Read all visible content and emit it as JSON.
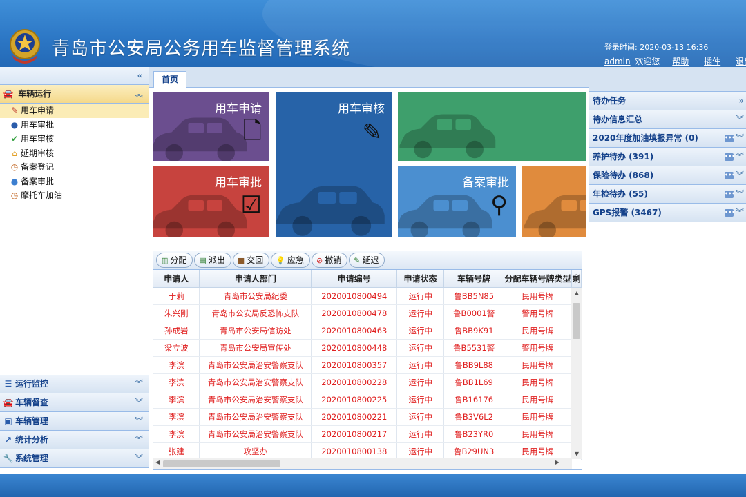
{
  "header": {
    "title": "青岛市公安局公务用车监督管理系统",
    "login_time_label": "登录时间:",
    "login_time": "2020-03-13 16:36",
    "user": "admin",
    "welcome": "欢迎您",
    "help": "帮助",
    "plugin": "插件",
    "logout": "退出"
  },
  "sidebar": {
    "collapse_icon": "«",
    "active_section": {
      "label": "车辆运行",
      "icon": "car-icon",
      "chevron": "︽",
      "items": [
        {
          "label": "用车申请",
          "icon": "edit-icon",
          "glyph": "✎",
          "color": "#c0392b",
          "selected": true
        },
        {
          "label": "用车审批",
          "icon": "approve-icon",
          "glyph": "●",
          "color": "#2a5caa"
        },
        {
          "label": "用车审核",
          "icon": "check-icon",
          "glyph": "✔",
          "color": "#2e9e3a"
        },
        {
          "label": "延期审核",
          "icon": "home-icon",
          "glyph": "⌂",
          "color": "#e2a12a"
        },
        {
          "label": "备案登记",
          "icon": "clock-icon",
          "glyph": "◷",
          "color": "#c0601a"
        },
        {
          "label": "备案审批",
          "icon": "globe-icon",
          "glyph": "●",
          "color": "#3c7fd0"
        },
        {
          "label": "摩托车加油",
          "icon": "clock-icon",
          "glyph": "◷",
          "color": "#c0601a"
        }
      ]
    },
    "sections": [
      {
        "label": "运行监控",
        "icon": "list-icon",
        "glyph": "☰",
        "chevron": "︾"
      },
      {
        "label": "车辆督查",
        "icon": "car-icon",
        "glyph": "🚘",
        "chevron": "︾"
      },
      {
        "label": "车辆管理",
        "icon": "folder-icon",
        "glyph": "▣",
        "chevron": "︾"
      },
      {
        "label": "统计分析",
        "icon": "chart-icon",
        "glyph": "↗",
        "chevron": "︾"
      },
      {
        "label": "系统管理",
        "icon": "wrench-icon",
        "glyph": "🔧",
        "chevron": "︾"
      }
    ]
  },
  "tabs": {
    "home": "首页"
  },
  "tiles": {
    "apply": {
      "label": "用车申请",
      "color": "#6b4e8f"
    },
    "review": {
      "label": "用车审核",
      "color": "#2763a8"
    },
    "approve": {
      "label": "用车审批",
      "color": "#c7433e"
    },
    "filing": {
      "label": "备案审批",
      "color": "#4b8fd0"
    },
    "green_color": "#3e9f6c",
    "orange_color": "#e08b3d"
  },
  "toolbar": [
    {
      "label": "分配",
      "icon": "assign-icon",
      "glyph": "▥",
      "color": "#2e7d32"
    },
    {
      "label": "派出",
      "icon": "dispatch-icon",
      "glyph": "▤",
      "color": "#2e7d32"
    },
    {
      "label": "交回",
      "icon": "return-icon",
      "glyph": "■",
      "color": "#8b5a2b"
    },
    {
      "label": "应急",
      "icon": "bulb-icon",
      "glyph": "💡",
      "color": "#e0a020"
    },
    {
      "label": "撤销",
      "icon": "cancel-icon",
      "glyph": "⊘",
      "color": "#d32f2f"
    },
    {
      "label": "延迟",
      "icon": "pencil-icon",
      "glyph": "✎",
      "color": "#2e7d32"
    }
  ],
  "table": {
    "columns": [
      "申请人",
      "申请人部门",
      "申请编号",
      "申请状态",
      "车辆号牌",
      "分配车辆号牌类型",
      "剩"
    ],
    "rows": [
      [
        "于莉",
        "青岛市公安局纪委",
        "2020010800494",
        "运行中",
        "鲁BB5N85",
        "民用号牌",
        ""
      ],
      [
        "朱兴刚",
        "青岛市公安局反恐怖支队",
        "2020010800478",
        "运行中",
        "鲁B0001警",
        "警用号牌",
        ""
      ],
      [
        "孙成岩",
        "青岛市公安局信访处",
        "2020010800463",
        "运行中",
        "鲁BB9K91",
        "民用号牌",
        ""
      ],
      [
        "梁立波",
        "青岛市公安局宣传处",
        "2020010800448",
        "运行中",
        "鲁B5531警",
        "警用号牌",
        ""
      ],
      [
        "李滨",
        "青岛市公安局治安警察支队",
        "2020010800357",
        "运行中",
        "鲁BB9L88",
        "民用号牌",
        ""
      ],
      [
        "李滨",
        "青岛市公安局治安警察支队",
        "2020010800228",
        "运行中",
        "鲁BB1L69",
        "民用号牌",
        ""
      ],
      [
        "李滨",
        "青岛市公安局治安警察支队",
        "2020010800225",
        "运行中",
        "鲁B16176",
        "民用号牌",
        ""
      ],
      [
        "李滨",
        "青岛市公安局治安警察支队",
        "2020010800221",
        "运行中",
        "鲁B3V6L2",
        "民用号牌",
        ""
      ],
      [
        "李滨",
        "青岛市公安局治安警察支队",
        "2020010800217",
        "运行中",
        "鲁B23YR0",
        "民用号牌",
        ""
      ],
      [
        "张建",
        "攻坚办",
        "2020010800138",
        "运行中",
        "鲁B29UN3",
        "民用号牌",
        ""
      ]
    ]
  },
  "right_panel": {
    "tasks": {
      "label": "待办任务",
      "chevron": "»"
    },
    "summary": {
      "label": "待办信息汇总",
      "chevron": "︾"
    },
    "items": [
      {
        "label": "2020年度加油填报异常 (0)",
        "chevron": "︾"
      },
      {
        "label": "养护待办 (391)",
        "chevron": "︾"
      },
      {
        "label": "保险待办 (868)",
        "chevron": "︾"
      },
      {
        "label": "年检待办 (55)",
        "chevron": "︾"
      },
      {
        "label": "GPS报警 (3467)",
        "chevron": "︾"
      }
    ]
  }
}
